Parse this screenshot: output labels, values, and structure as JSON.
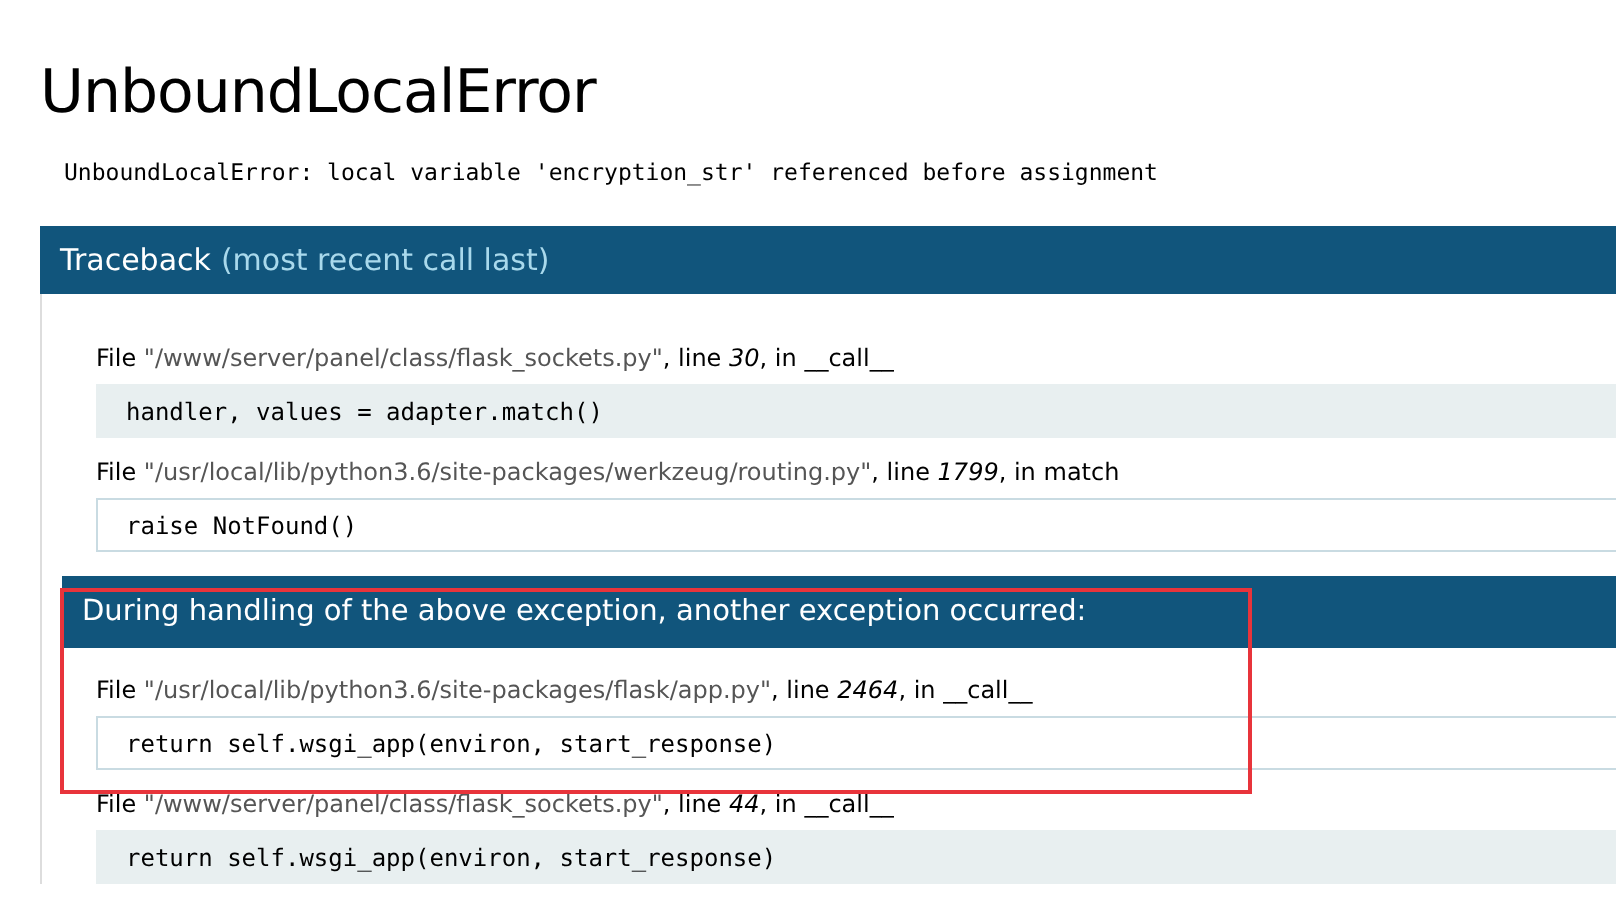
{
  "title": "UnboundLocalError",
  "message": "UnboundLocalError: local variable 'encryption_str' referenced before assignment",
  "traceback": {
    "heading": "Traceback",
    "note": "(most recent call last)"
  },
  "sections": [
    {
      "frames": [
        {
          "file_word": "File",
          "path": "\"/www/server/panel/class/flask_sockets.py\"",
          "line_word": ", line",
          "line": "30",
          "in_word": ", in",
          "function": "__call__",
          "code": "handler, values = adapter.match()",
          "library": false
        },
        {
          "file_word": "File",
          "path": "\"/usr/local/lib/python3.6/site-packages/werkzeug/routing.py\"",
          "line_word": ", line",
          "line": "1799",
          "in_word": ", in",
          "function": "match",
          "code": "raise NotFound()",
          "library": true
        }
      ]
    },
    {
      "heading": "During handling of the above exception, another exception occurred:",
      "highlighted": true,
      "frames": [
        {
          "file_word": "File",
          "path": "\"/usr/local/lib/python3.6/site-packages/flask/app.py\"",
          "line_word": ", line",
          "line": "2464",
          "in_word": ", in",
          "function": "__call__",
          "code": "return self.wsgi_app(environ, start_response)",
          "library": true
        },
        {
          "file_word": "File",
          "path": "\"/www/server/panel/class/flask_sockets.py\"",
          "line_word": ", line",
          "line": "44",
          "in_word": ", in",
          "function": "__call__",
          "code": "return self.wsgi_app(environ, start_response)",
          "library": false
        }
      ]
    }
  ]
}
